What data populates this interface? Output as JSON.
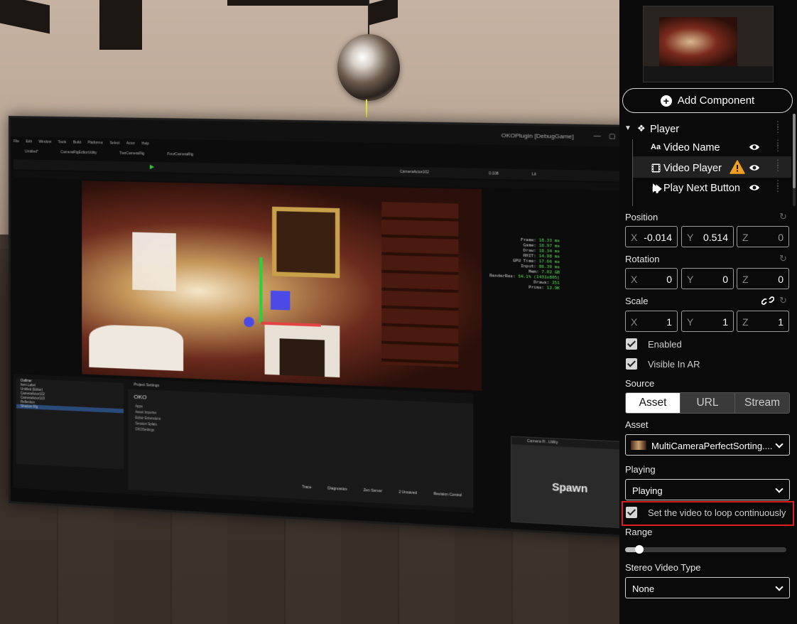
{
  "monitor": {
    "window_title": "OKOPlugin [DebugGame]",
    "menu": [
      "File",
      "Edit",
      "Window",
      "Tools",
      "Build",
      "Platforms",
      "Select",
      "Actor",
      "Help"
    ],
    "tabs": [
      "Untitled*",
      "CameraRigEditorUtility",
      "TwoCameraRig",
      "FourCameraRig"
    ],
    "camera_selector": "CameraActor102",
    "speed": "0.108",
    "view_mode": "Lit",
    "stats": [
      {
        "k": "Frame:",
        "v": "18.33 ms"
      },
      {
        "k": "Game:",
        "v": "10.97 ms"
      },
      {
        "k": "Draw:",
        "v": "18.34 ms"
      },
      {
        "k": "RHIT:",
        "v": "14.98 ms"
      },
      {
        "k": "GPU Time:",
        "v": "17.66 ms"
      },
      {
        "k": "Input:",
        "v": "86.39 ms"
      },
      {
        "k": "Mem:",
        "v": "7.02 GB"
      },
      {
        "k": "RenderRes:",
        "v": "54.1% (1431x805)"
      },
      {
        "k": "Draws:",
        "v": "251"
      },
      {
        "k": "Prims:",
        "v": "12.9K"
      }
    ],
    "outliner_tabs": [
      "Outliner",
      "Details",
      "Home"
    ],
    "outliner_rows": [
      "Item Label",
      "Untitled (Editor)",
      "CameraActor102",
      "CameraActor103",
      "Reflection",
      "Shadow Rig"
    ],
    "project_settings_tab": "Project Settings",
    "oko_label": "OKO",
    "project_items": [
      "Apps",
      "Asset Importer",
      "Editor Extensions",
      "Session Splats",
      "OKOSettings"
    ],
    "spawn_tab": "Camera R...Utility",
    "spawn_label": "Spawn",
    "status_items": [
      "Trace",
      "Diagnostics",
      "Zen Server",
      "2 Unsaved",
      "Revision Control"
    ]
  },
  "panel": {
    "add_component": "Add Component",
    "tree": {
      "root": "Player",
      "items": [
        {
          "label": "Video Name",
          "icon": "text-icon"
        },
        {
          "label": "Video Player",
          "icon": "film-icon",
          "warning": true
        },
        {
          "label": "Play Next Button",
          "icon": "cursor-icon"
        }
      ]
    },
    "position": {
      "label": "Position",
      "x": "-0.014",
      "y": "0.514",
      "z": "0"
    },
    "rotation": {
      "label": "Rotation",
      "x": "0",
      "y": "0",
      "z": "0"
    },
    "scale": {
      "label": "Scale",
      "x": "1",
      "y": "1",
      "z": "1"
    },
    "axis": {
      "x": "X",
      "y": "Y",
      "z": "Z"
    },
    "enabled": {
      "label": "Enabled",
      "checked": true
    },
    "visible_ar": {
      "label": "Visible In AR",
      "checked": true
    },
    "source": {
      "label": "Source",
      "options": [
        "Asset",
        "URL",
        "Stream"
      ],
      "selected": "Asset"
    },
    "asset": {
      "label": "Asset",
      "value": "MultiCameraPerfectSorting...."
    },
    "playing": {
      "label": "Playing",
      "value": "Playing"
    },
    "loop": {
      "label": "Set the video to loop continuously",
      "checked": true
    },
    "range": {
      "label": "Range",
      "value": 0.05
    },
    "stereo": {
      "label": "Stereo Video Type",
      "value": "None"
    }
  }
}
